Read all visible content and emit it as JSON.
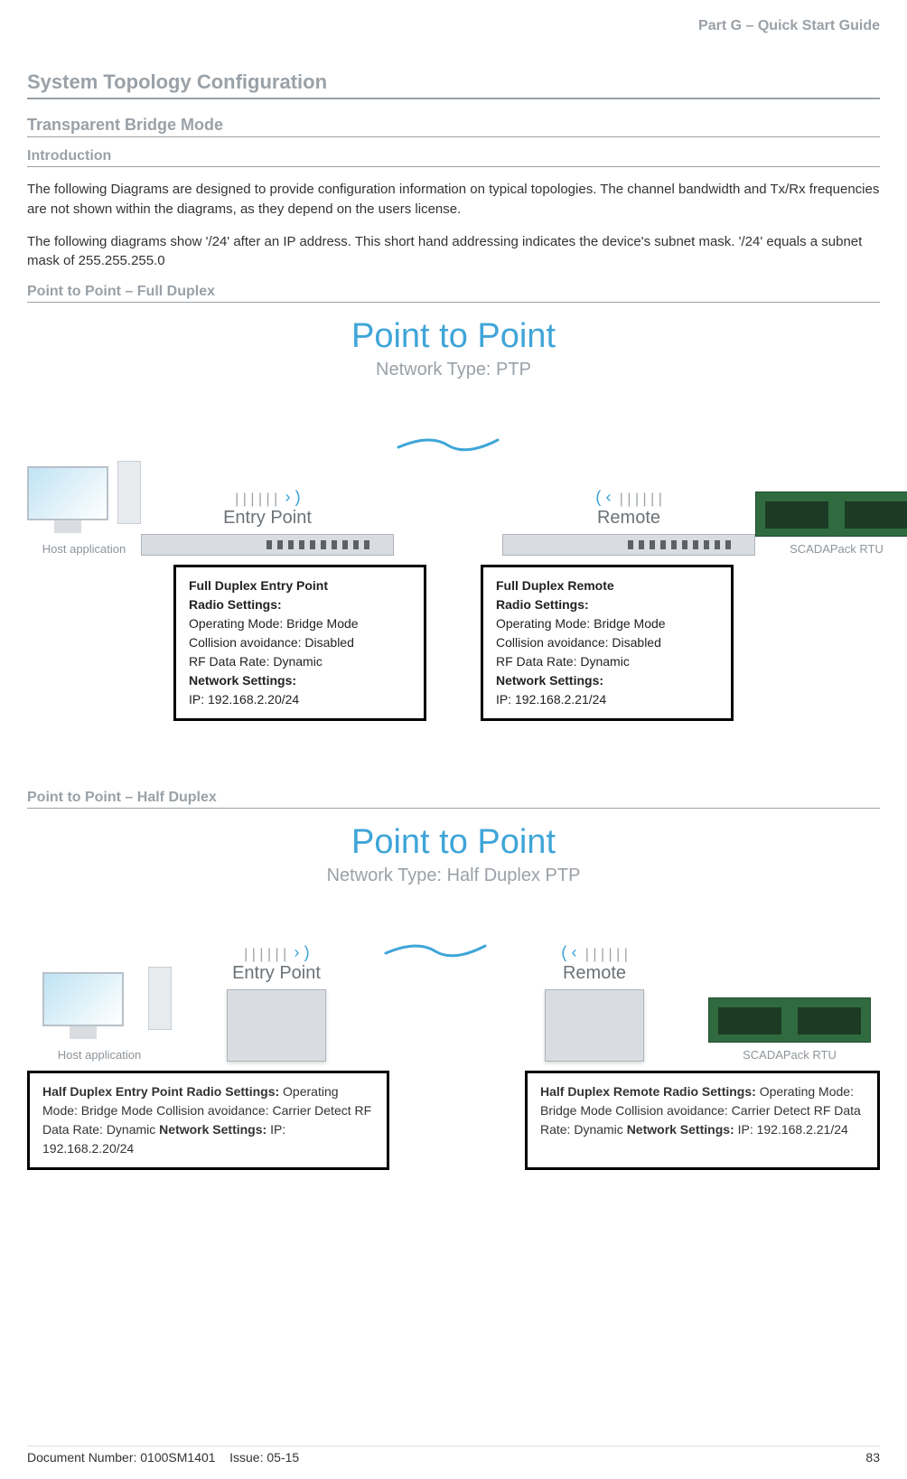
{
  "header": {
    "part": "Part G – Quick Start Guide"
  },
  "title": "System Topology Configuration",
  "sub1": "Transparent Bridge Mode",
  "sub2": "Introduction",
  "para1": "The following Diagrams are designed to provide configuration information on typical topologies. The channel bandwidth and Tx/Rx frequencies are not shown within the diagrams, as they depend on the users license.",
  "para2": "The following diagrams show '/24' after an IP address. This short hand addressing indicates the device's subnet mask. '/24' equals a subnet mask of 255.255.255.0",
  "diag1": {
    "heading": "Point to Point – Full Duplex",
    "title": "Point to Point",
    "subtitle": "Network Type: PTP",
    "entry_label": "Entry Point",
    "remote_label": "Remote",
    "host_label": "Host application",
    "rtu_label": "SCADAPack RTU",
    "left": {
      "title": "Full Duplex Entry Point",
      "rs": "Radio Settings:",
      "l1": "Operating Mode: Bridge Mode",
      "l2": "Collision avoidance: Disabled",
      "l3": "RF Data Rate: Dynamic",
      "ns": "Network Settings:",
      "ip": "IP: 192.168.2.20/24"
    },
    "right": {
      "title": "Full Duplex Remote",
      "rs": "Radio Settings:",
      "l1": "Operating Mode: Bridge Mode",
      "l2": "Collision avoidance: Disabled",
      "l3": "RF Data Rate: Dynamic",
      "ns": "Network Settings:",
      "ip": "IP: 192.168.2.21/24"
    }
  },
  "diag2": {
    "heading": "Point to Point – Half Duplex",
    "title": "Point to Point",
    "subtitle": "Network Type: Half Duplex PTP",
    "entry_label": "Entry Point",
    "remote_label": "Remote",
    "host_label": "Host application",
    "rtu_label": "SCADAPack RTU",
    "left": {
      "title": "Half Duplex Entry Point",
      "rs": "Radio Settings:",
      "l1": "Operating Mode: Bridge Mode",
      "l2": "Collision avoidance: Carrier Detect",
      "l3": "RF Data Rate: Dynamic",
      "ns": "Network Settings:",
      "ip": "IP: 192.168.2.20/24"
    },
    "right": {
      "title": "Half Duplex Remote",
      "rs": "Radio Settings:",
      "l1": "Operating Mode: Bridge Mode",
      "l2": "Collision avoidance: Carrier Detect",
      "l3": "RF Data Rate: Dynamic",
      "ns": "Network Settings:",
      "ip": "IP: 192.168.2.21/24"
    }
  },
  "footer": {
    "doc": "Document Number: 0100SM1401",
    "issue": "Issue: 05-15",
    "page": "83"
  }
}
